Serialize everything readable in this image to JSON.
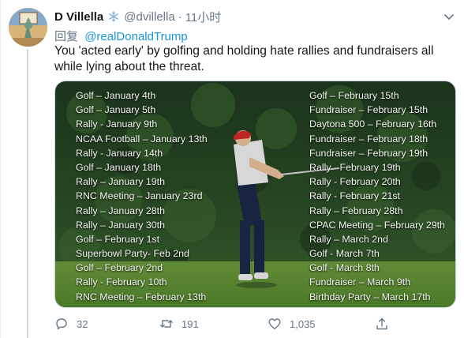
{
  "tweet": {
    "display_name": "D Villella",
    "handle": "@dvillella",
    "separator": "·",
    "time": "11小时",
    "reply_prefix": "回复",
    "reply_to": "@realDonaldTrump",
    "text": "You 'acted early' by golfing and holding hate rallies and fundraisers all while lying about the threat.",
    "badge_icon": "snowflake-icon"
  },
  "image": {
    "left_column": [
      "Golf – January 4th",
      "Golf – January 5th",
      "Rally - January 9th",
      "NCAA Football – January 13th",
      "Rally - January 14th",
      "Golf – January 18th",
      "Rally – January 19th",
      "RNC Meeting – January 23rd",
      "Rally – January 28th",
      "Rally – January 30th",
      "Golf – February 1st",
      "Superbowl Party- Feb 2nd",
      "Golf – February 2nd",
      "Rally - February 10th",
      "RNC Meeting – February 13th"
    ],
    "right_column": [
      "Golf – February 15th",
      "Fundraiser – February 15th",
      "Daytona 500 – February 16th",
      "Fundraiser – February 18th",
      "Fundraiser – February 19th",
      "Rally - February 19th",
      "Rally - February 20th",
      "Rally - February 21st",
      "Rally – February 28th",
      "CPAC Meeting – February 29th",
      "Rally – March 2nd",
      "Golf - March 7th",
      "Golf - March 8th",
      "Fundraiser – March 9th",
      "Birthday Party – March 17th"
    ]
  },
  "actions": {
    "replies": "32",
    "retweets": "191",
    "likes": "1,035"
  },
  "colors": {
    "link": "#1b95e0",
    "muted": "#657786",
    "text": "#14171a"
  }
}
